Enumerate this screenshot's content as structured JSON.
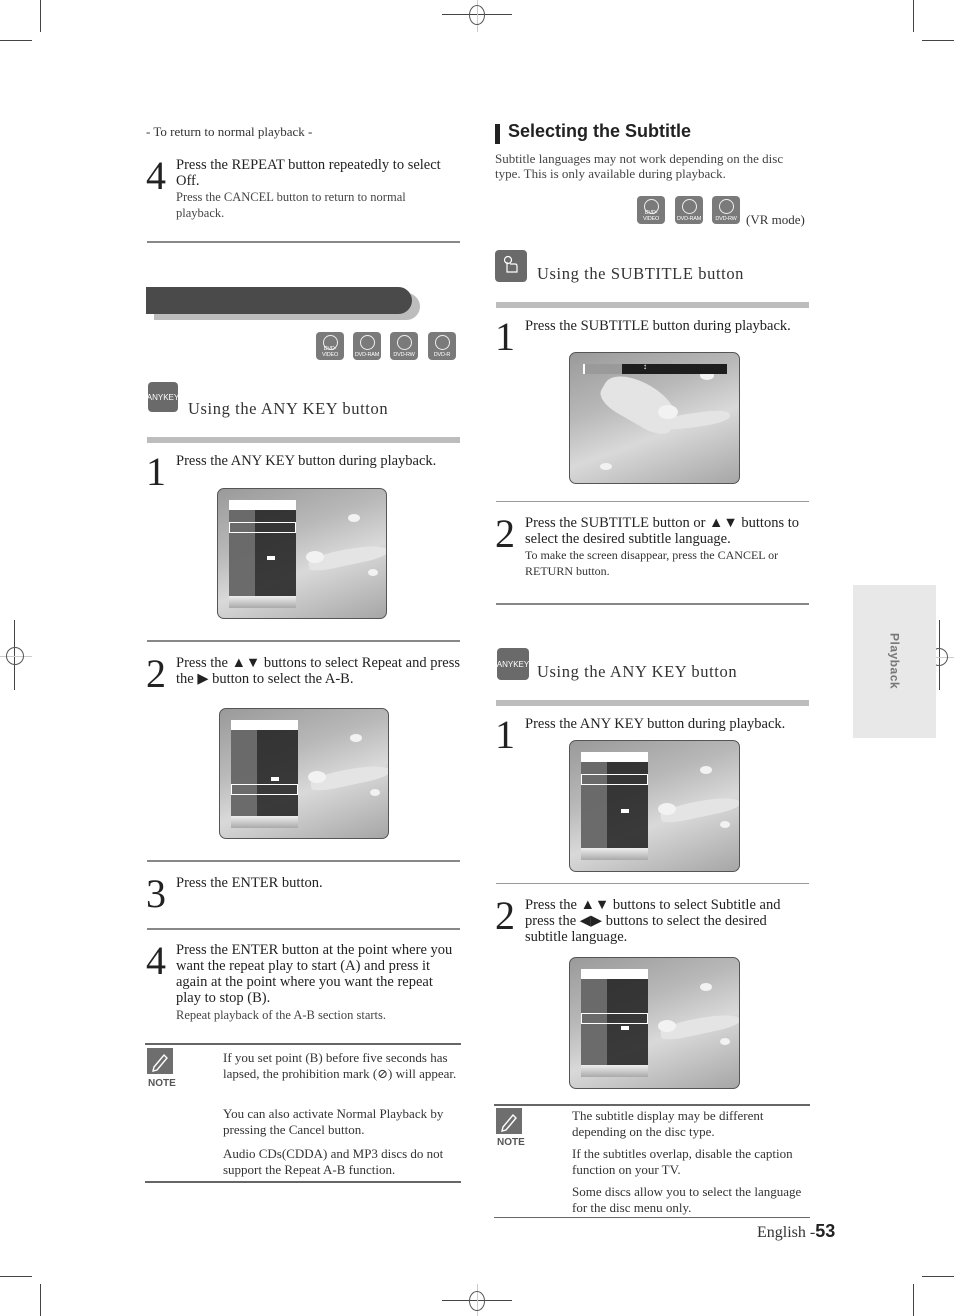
{
  "left": {
    "return_heading": "- To return to normal playback -",
    "step4_repeat": {
      "number": "4",
      "text": "Press the REPEAT button repeatedly to select Off.",
      "subtext": "Press the CANCEL button to return to normal playback."
    },
    "section_bar_title": "",
    "disc_badges": [
      "DVD-VIDEO",
      "DVD-RAM",
      "DVD-RW",
      "DVD-R"
    ],
    "anykey_section": {
      "badge": "ANYKEY",
      "title": "Using the ANY KEY button"
    },
    "steps": [
      {
        "number": "1",
        "text": "Press the ANY KEY button during playback."
      },
      {
        "number": "2",
        "text": "Press the ▲▼ buttons to select Repeat and press the ▶ button to select the A-B."
      },
      {
        "number": "3",
        "text": "Press the ENTER button."
      },
      {
        "number": "4",
        "text": "Press the ENTER button at the point where you want the repeat play to start (A) and press it again at the point where you want the repeat play to stop (B).",
        "subtext": "Repeat playback of the A-B section starts."
      }
    ],
    "note": {
      "label": "NOTE",
      "items": [
        "If you set point (B) before five seconds has lapsed, the prohibition mark (⊘) will appear.",
        "You can also activate Normal Playback by pressing the Cancel button.",
        "Audio CDs(CDDA) and MP3 discs do not support the Repeat A-B function."
      ]
    }
  },
  "right": {
    "title": "Selecting the Subtitle",
    "intro": "Subtitle languages may not work depending on the disc type. This is only available during playback.",
    "disc_badges": [
      "DVD-VIDEO",
      "DVD-RAM",
      "DVD-RW"
    ],
    "disc_note": "(VR mode)",
    "subtitle_section": {
      "title": "Using the SUBTITLE button",
      "steps": [
        {
          "number": "1",
          "text": "Press the SUBTITLE button during playback."
        },
        {
          "number": "2",
          "text": "Press the SUBTITLE button or ▲▼ buttons to select the desired subtitle language.",
          "subtext": "To make the screen disappear,  press the CANCEL or RETURN button."
        }
      ]
    },
    "anykey_section": {
      "badge": "ANYKEY",
      "title": "Using the ANY KEY button",
      "steps": [
        {
          "number": "1",
          "text": "Press the ANY KEY button during playback."
        },
        {
          "number": "2",
          "text": "Press the ▲▼ buttons to select Subtitle and press the ◀▶ buttons to select the desired subtitle language."
        }
      ]
    },
    "note": {
      "label": "NOTE",
      "items": [
        "The subtitle display may be different depending on the disc type.",
        "If the subtitles overlap, disable the caption function on your TV.",
        "Some discs allow you to select the language for the disc menu only."
      ]
    }
  },
  "side_tab": "Playback",
  "footer": {
    "language": "English -",
    "page_number": "53"
  },
  "colors": {
    "badge_gray": "#6a6a6a",
    "rule_gray": "#bdbdbd",
    "side_tab_bg": "#e8e8e8"
  }
}
